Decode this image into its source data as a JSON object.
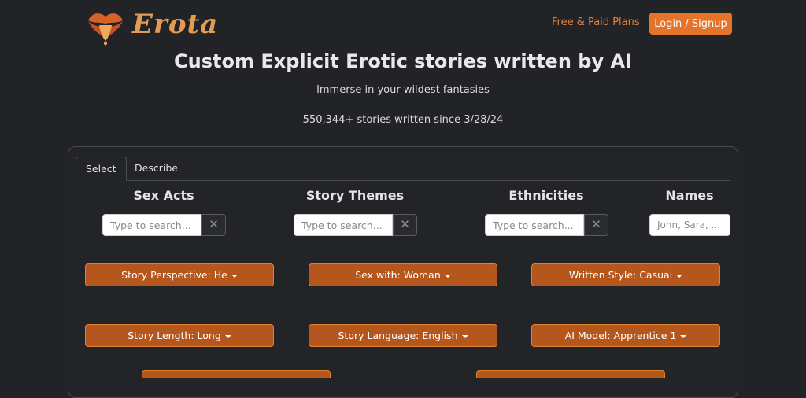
{
  "nav": {
    "logo_text": "Erota",
    "plans_link": "Free & Paid Plans",
    "login_button": "Login / Signup"
  },
  "hero": {
    "title": "Custom Explicit Erotic stories written by AI",
    "subtitle": "Immerse in your wildest fantasies",
    "count_text": "550,344+ stories written since 3/28/24"
  },
  "tabs": [
    {
      "label": "Select",
      "active": true
    },
    {
      "label": "Describe",
      "active": false
    }
  ],
  "columns": {
    "sex_acts": {
      "title": "Sex Acts",
      "placeholder": "Type to search..."
    },
    "story_themes": {
      "title": "Story Themes",
      "placeholder": "Type to search..."
    },
    "ethnicities": {
      "title": "Ethnicities",
      "placeholder": "Type to search..."
    },
    "names": {
      "title": "Names",
      "placeholder": "John, Sara, ..."
    }
  },
  "clear_glyph": "✕",
  "dropdowns": {
    "perspective": "Story Perspective: He",
    "sex_with": "Sex with: Woman",
    "style": "Written Style: Casual",
    "length": "Story Length: Long",
    "language": "Story Language: English",
    "model": "AI Model: Apprentice 1"
  },
  "colors": {
    "accent": "#e4742a",
    "dropdown_bg": "#b5561c",
    "background": "#222327"
  }
}
